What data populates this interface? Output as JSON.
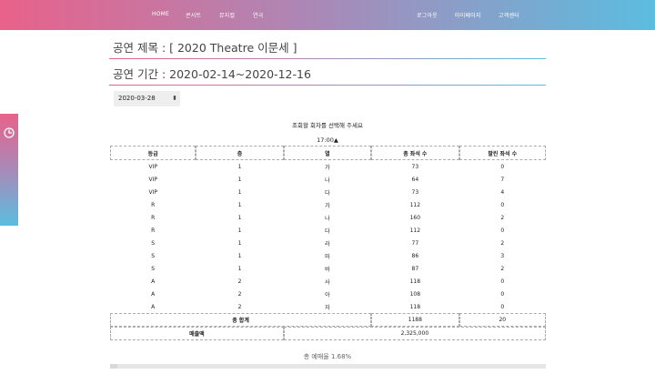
{
  "nav": {
    "home": "HOME",
    "concert": "콘서트",
    "musical": "뮤지컬",
    "theater": "연극",
    "logout": "로그아웃",
    "mypage": "마이페이지",
    "support": "고객센터"
  },
  "side_tab": {
    "icon": "clock-icon"
  },
  "performance": {
    "title_line": "공연 제목 : [ 2020 Theatre 이문세 ]",
    "period_line": "공연 기간 : 2020-02-14~2020-12-16"
  },
  "date_select": {
    "value": "2020-03-28",
    "arrow": "▴▾"
  },
  "prompt": "조회할 회차를 선택해 주세요",
  "showtime": "17:00▲",
  "table": {
    "headers": [
      "등급",
      "층",
      "열",
      "총 좌석 수",
      "팔린 좌석 수"
    ],
    "rows": [
      [
        "VIP",
        "1",
        "가",
        "73",
        "0"
      ],
      [
        "VIP",
        "1",
        "나",
        "64",
        "7"
      ],
      [
        "VIP",
        "1",
        "다",
        "73",
        "4"
      ],
      [
        "R",
        "1",
        "가",
        "112",
        "0"
      ],
      [
        "R",
        "1",
        "나",
        "160",
        "2"
      ],
      [
        "R",
        "1",
        "다",
        "112",
        "0"
      ],
      [
        "S",
        "1",
        "라",
        "77",
        "2"
      ],
      [
        "S",
        "1",
        "마",
        "86",
        "3"
      ],
      [
        "S",
        "1",
        "바",
        "87",
        "2"
      ],
      [
        "A",
        "2",
        "사",
        "118",
        "0"
      ],
      [
        "A",
        "2",
        "아",
        "108",
        "0"
      ],
      [
        "A",
        "2",
        "자",
        "118",
        "0"
      ]
    ],
    "total_label": "총 합계",
    "total_seats": "1188",
    "total_sold": "20",
    "revenue_label": "매출액",
    "revenue_value": "2,325,000"
  },
  "reservation": {
    "rate_text": "총 예매율 1.68%",
    "rate_fraction": 0.0168
  }
}
